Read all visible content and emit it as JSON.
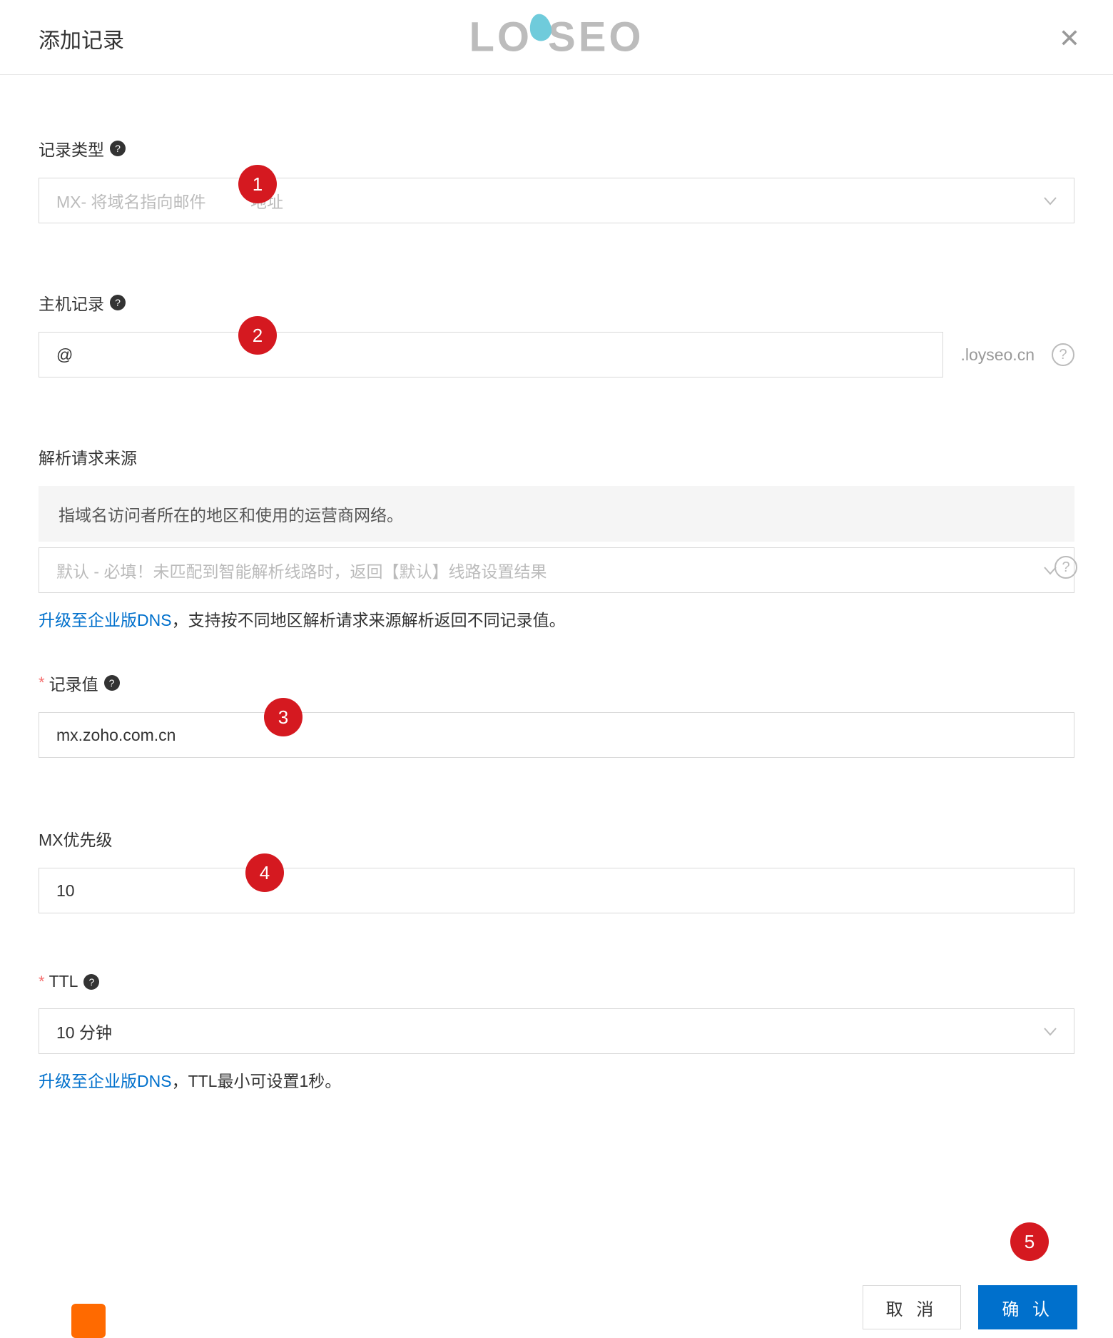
{
  "header": {
    "title": "添加记录"
  },
  "logo": {
    "text_left": "LO",
    "text_right": "SEO"
  },
  "fields": {
    "record_type": {
      "label": "记录类型",
      "value": "",
      "placeholder_a": "MX- 将域名指向邮件",
      "placeholder_b": "地址"
    },
    "host": {
      "label": "主机记录",
      "value": "@",
      "suffix": ".loyseo.cn"
    },
    "source": {
      "label": "解析请求来源",
      "info": "指域名访问者所在的地区和使用的运营商网络。",
      "placeholder": "默认 - 必填！未匹配到智能解析线路时，返回【默认】线路设置结果",
      "hint_link": "升级至企业版DNS",
      "hint_rest": "，支持按不同地区解析请求来源解析返回不同记录值。"
    },
    "record_value": {
      "label": "记录值",
      "value": "mx.zoho.com.cn"
    },
    "mx_priority": {
      "label": "MX优先级",
      "value": "10"
    },
    "ttl": {
      "label": "TTL",
      "value": "10 分钟",
      "hint_link": "升级至企业版DNS",
      "hint_rest": "，TTL最小可设置1秒。"
    }
  },
  "markers": {
    "m1": "1",
    "m2": "2",
    "m3": "3",
    "m4": "4",
    "m5": "5"
  },
  "footer": {
    "cancel": "取 消",
    "confirm": "确 认"
  }
}
